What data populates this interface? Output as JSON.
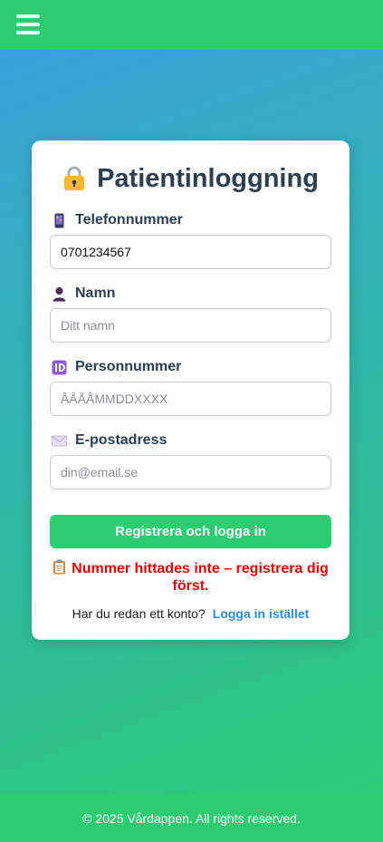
{
  "header": {
    "menu_icon": "hamburger-menu-icon"
  },
  "login": {
    "title": "Patientinloggning",
    "title_icon": "lock-icon",
    "fields": {
      "phone": {
        "label": "Telefonnummer",
        "icon": "mobile-phone-icon",
        "value": "0701234567",
        "placeholder": ""
      },
      "name": {
        "label": "Namn",
        "icon": "person-icon",
        "value": "",
        "placeholder": "Ditt namn"
      },
      "personal_number": {
        "label": "Personnummer",
        "icon": "id-icon",
        "value": "",
        "placeholder": "ÅÅÅÅMMDDXXXX"
      },
      "email": {
        "label": "E-postadress",
        "icon": "envelope-icon",
        "value": "",
        "placeholder": "din@email.se"
      }
    },
    "submit_label": "Registrera och logga in",
    "error_message": "Nummer hittades inte – registrera dig först.",
    "error_icon": "clipboard-icon",
    "existing_account_text": "Har du redan ett konto?",
    "login_instead_link": "Logga in istället"
  },
  "footer": {
    "copyright": "© 2025 Vårdappen. All rights reserved."
  },
  "colors": {
    "accent_green": "#2ecc71",
    "link_blue": "#2e8bd6",
    "error_red": "#e60000",
    "title_dark": "#2c3e50"
  }
}
